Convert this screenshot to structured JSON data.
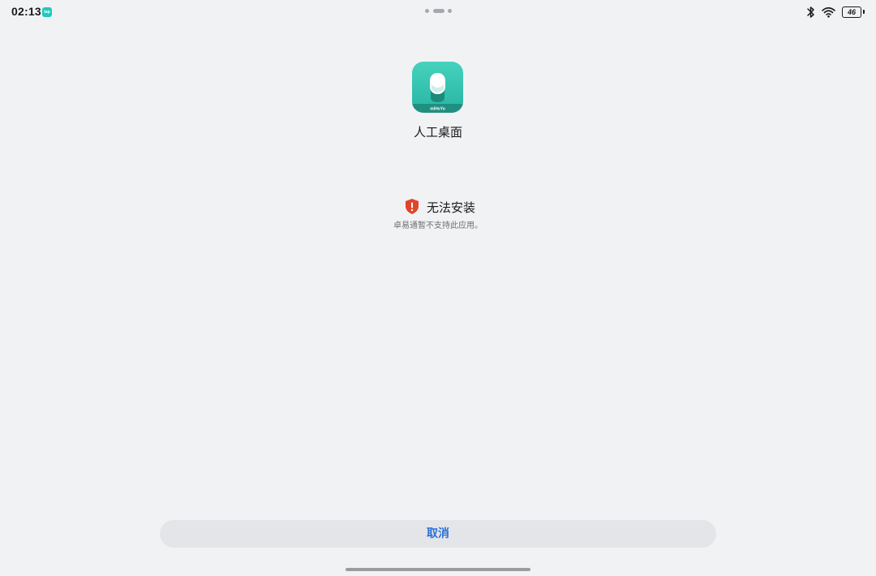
{
  "status_bar": {
    "time": "02:13",
    "notification_icon": "app-notification-icon",
    "battery_level": "46",
    "icons": [
      "bluetooth-icon",
      "wifi-icon",
      "battery-icon"
    ]
  },
  "app": {
    "name": "人工桌面",
    "icon": "app-icon",
    "icon_colors": [
      "#45d2bd",
      "#27b5a3"
    ]
  },
  "error": {
    "icon": "shield-alert-icon",
    "icon_color": "#e0452c",
    "title": "无法安装",
    "message": "卓易通暂不支持此应用。"
  },
  "actions": {
    "cancel_label": "取消",
    "cancel_color": "#2a6fd6"
  }
}
